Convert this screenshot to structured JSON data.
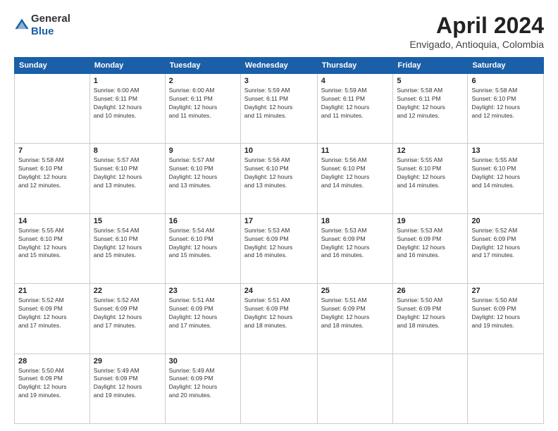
{
  "header": {
    "logo_line1": "General",
    "logo_line2": "Blue",
    "month_title": "April 2024",
    "location": "Envigado, Antioquia, Colombia"
  },
  "weekdays": [
    "Sunday",
    "Monday",
    "Tuesday",
    "Wednesday",
    "Thursday",
    "Friday",
    "Saturday"
  ],
  "weeks": [
    [
      {
        "day": "",
        "info": ""
      },
      {
        "day": "1",
        "info": "Sunrise: 6:00 AM\nSunset: 6:11 PM\nDaylight: 12 hours\nand 10 minutes."
      },
      {
        "day": "2",
        "info": "Sunrise: 6:00 AM\nSunset: 6:11 PM\nDaylight: 12 hours\nand 11 minutes."
      },
      {
        "day": "3",
        "info": "Sunrise: 5:59 AM\nSunset: 6:11 PM\nDaylight: 12 hours\nand 11 minutes."
      },
      {
        "day": "4",
        "info": "Sunrise: 5:59 AM\nSunset: 6:11 PM\nDaylight: 12 hours\nand 11 minutes."
      },
      {
        "day": "5",
        "info": "Sunrise: 5:58 AM\nSunset: 6:11 PM\nDaylight: 12 hours\nand 12 minutes."
      },
      {
        "day": "6",
        "info": "Sunrise: 5:58 AM\nSunset: 6:10 PM\nDaylight: 12 hours\nand 12 minutes."
      }
    ],
    [
      {
        "day": "7",
        "info": "Sunrise: 5:58 AM\nSunset: 6:10 PM\nDaylight: 12 hours\nand 12 minutes."
      },
      {
        "day": "8",
        "info": "Sunrise: 5:57 AM\nSunset: 6:10 PM\nDaylight: 12 hours\nand 13 minutes."
      },
      {
        "day": "9",
        "info": "Sunrise: 5:57 AM\nSunset: 6:10 PM\nDaylight: 12 hours\nand 13 minutes."
      },
      {
        "day": "10",
        "info": "Sunrise: 5:56 AM\nSunset: 6:10 PM\nDaylight: 12 hours\nand 13 minutes."
      },
      {
        "day": "11",
        "info": "Sunrise: 5:56 AM\nSunset: 6:10 PM\nDaylight: 12 hours\nand 14 minutes."
      },
      {
        "day": "12",
        "info": "Sunrise: 5:55 AM\nSunset: 6:10 PM\nDaylight: 12 hours\nand 14 minutes."
      },
      {
        "day": "13",
        "info": "Sunrise: 5:55 AM\nSunset: 6:10 PM\nDaylight: 12 hours\nand 14 minutes."
      }
    ],
    [
      {
        "day": "14",
        "info": "Sunrise: 5:55 AM\nSunset: 6:10 PM\nDaylight: 12 hours\nand 15 minutes."
      },
      {
        "day": "15",
        "info": "Sunrise: 5:54 AM\nSunset: 6:10 PM\nDaylight: 12 hours\nand 15 minutes."
      },
      {
        "day": "16",
        "info": "Sunrise: 5:54 AM\nSunset: 6:10 PM\nDaylight: 12 hours\nand 15 minutes."
      },
      {
        "day": "17",
        "info": "Sunrise: 5:53 AM\nSunset: 6:09 PM\nDaylight: 12 hours\nand 16 minutes."
      },
      {
        "day": "18",
        "info": "Sunrise: 5:53 AM\nSunset: 6:09 PM\nDaylight: 12 hours\nand 16 minutes."
      },
      {
        "day": "19",
        "info": "Sunrise: 5:53 AM\nSunset: 6:09 PM\nDaylight: 12 hours\nand 16 minutes."
      },
      {
        "day": "20",
        "info": "Sunrise: 5:52 AM\nSunset: 6:09 PM\nDaylight: 12 hours\nand 17 minutes."
      }
    ],
    [
      {
        "day": "21",
        "info": "Sunrise: 5:52 AM\nSunset: 6:09 PM\nDaylight: 12 hours\nand 17 minutes."
      },
      {
        "day": "22",
        "info": "Sunrise: 5:52 AM\nSunset: 6:09 PM\nDaylight: 12 hours\nand 17 minutes."
      },
      {
        "day": "23",
        "info": "Sunrise: 5:51 AM\nSunset: 6:09 PM\nDaylight: 12 hours\nand 17 minutes."
      },
      {
        "day": "24",
        "info": "Sunrise: 5:51 AM\nSunset: 6:09 PM\nDaylight: 12 hours\nand 18 minutes."
      },
      {
        "day": "25",
        "info": "Sunrise: 5:51 AM\nSunset: 6:09 PM\nDaylight: 12 hours\nand 18 minutes."
      },
      {
        "day": "26",
        "info": "Sunrise: 5:50 AM\nSunset: 6:09 PM\nDaylight: 12 hours\nand 18 minutes."
      },
      {
        "day": "27",
        "info": "Sunrise: 5:50 AM\nSunset: 6:09 PM\nDaylight: 12 hours\nand 19 minutes."
      }
    ],
    [
      {
        "day": "28",
        "info": "Sunrise: 5:50 AM\nSunset: 6:09 PM\nDaylight: 12 hours\nand 19 minutes."
      },
      {
        "day": "29",
        "info": "Sunrise: 5:49 AM\nSunset: 6:09 PM\nDaylight: 12 hours\nand 19 minutes."
      },
      {
        "day": "30",
        "info": "Sunrise: 5:49 AM\nSunset: 6:09 PM\nDaylight: 12 hours\nand 20 minutes."
      },
      {
        "day": "",
        "info": ""
      },
      {
        "day": "",
        "info": ""
      },
      {
        "day": "",
        "info": ""
      },
      {
        "day": "",
        "info": ""
      }
    ]
  ]
}
